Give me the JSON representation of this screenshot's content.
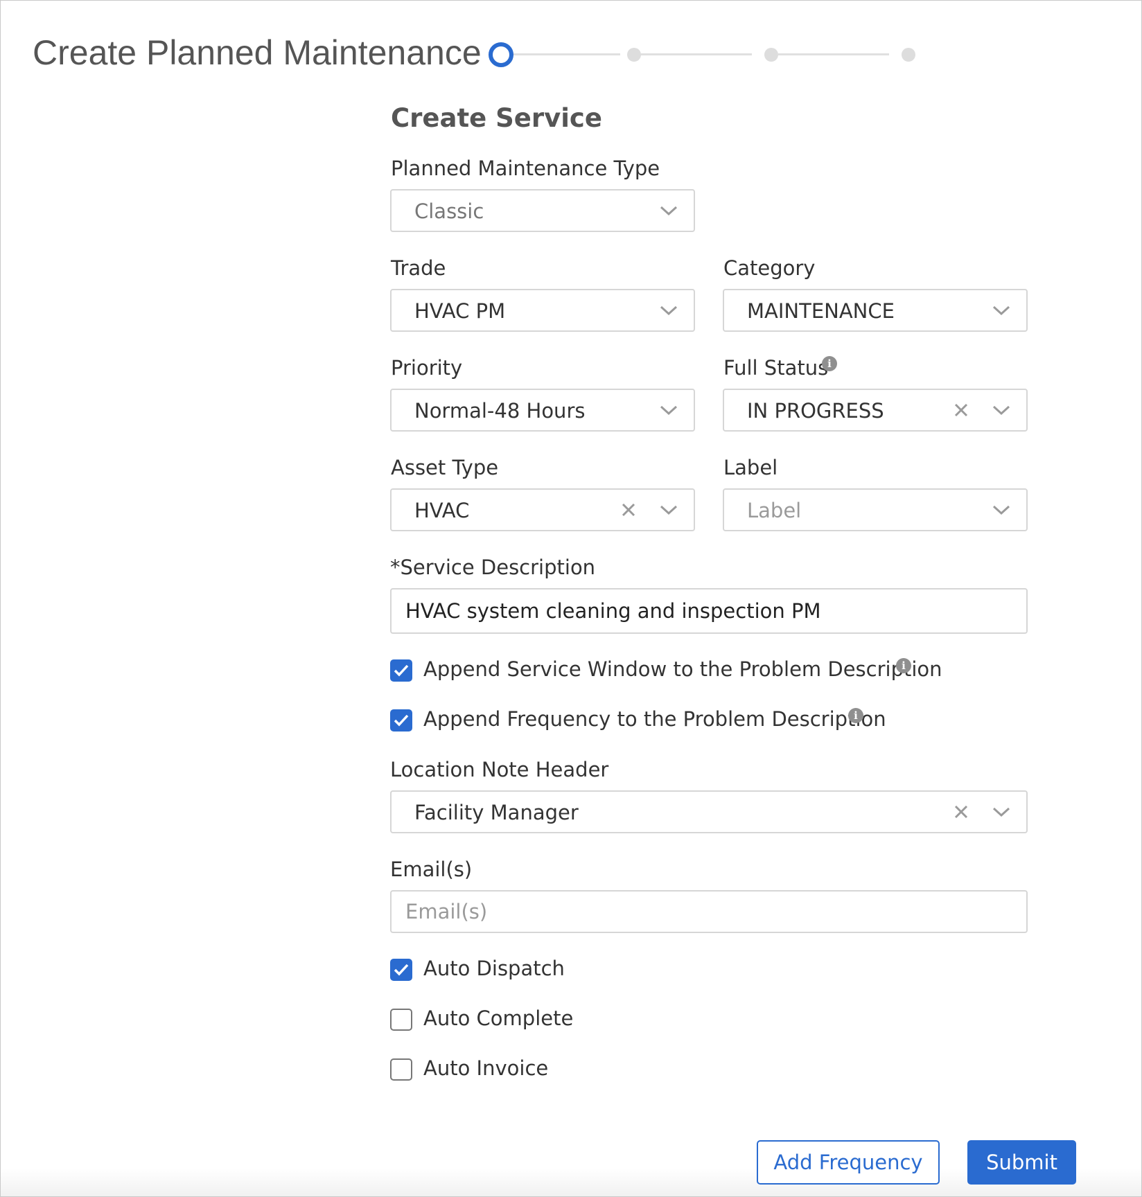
{
  "page": {
    "title": "Create Planned Maintenance",
    "stepper": {
      "total_steps": 4,
      "current_step": 1
    }
  },
  "form": {
    "section_title": "Create Service",
    "pm_type": {
      "label": "Planned Maintenance Type",
      "value": "Classic"
    },
    "trade": {
      "label": "Trade",
      "value": "HVAC PM"
    },
    "category": {
      "label": "Category",
      "value": "MAINTENANCE"
    },
    "priority": {
      "label": "Priority",
      "value": "Normal-48 Hours"
    },
    "full_status": {
      "label": "Full Status",
      "value": "IN PROGRESS"
    },
    "asset_type": {
      "label": "Asset Type",
      "value": "HVAC"
    },
    "label_field": {
      "label": "Label",
      "placeholder": "Label"
    },
    "service_description": {
      "label": "*Service Description",
      "value": "HVAC system cleaning and inspection PM"
    },
    "append_service_window": {
      "label": "Append Service Window to the Problem Description",
      "checked": true
    },
    "append_frequency": {
      "label": "Append Frequency to the Problem Description",
      "checked": true
    },
    "location_note_header": {
      "label": "Location Note Header",
      "value": "Facility Manager"
    },
    "emails": {
      "label": "Email(s)",
      "placeholder": "Email(s)"
    },
    "auto_dispatch": {
      "label": "Auto Dispatch",
      "checked": true
    },
    "auto_complete": {
      "label": "Auto Complete",
      "checked": false
    },
    "auto_invoice": {
      "label": "Auto Invoice",
      "checked": false
    }
  },
  "actions": {
    "add_frequency_label": "Add Frequency",
    "submit_label": "Submit"
  },
  "icons": {
    "dropdown": "chevron-down-icon",
    "clear": "close-icon",
    "info": "info-icon",
    "check": "checkmark-icon"
  },
  "colors": {
    "accent": "#2a6bd0",
    "border": "#d6d6d6",
    "title_text": "#555555",
    "muted_text": "#9a9a9a"
  }
}
